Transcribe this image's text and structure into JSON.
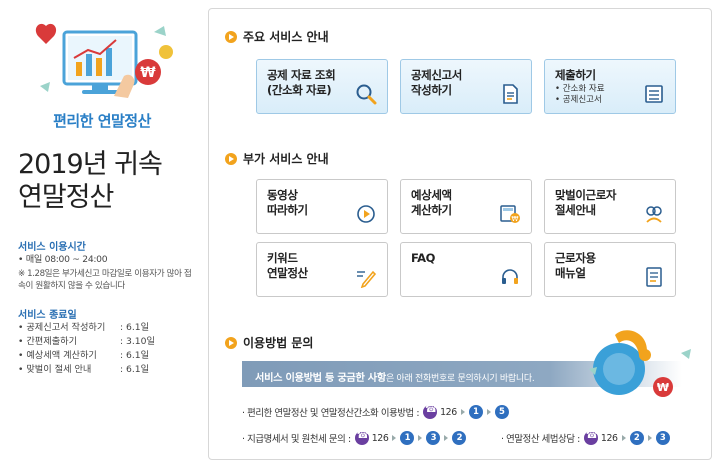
{
  "left": {
    "hero_subtitle": "편리한 연말정산",
    "title_line1": "2019년 귀속",
    "title_line2": "연말정산",
    "hours_heading": "서비스 이용시간",
    "hours_text": "• 매일 08:00 ~ 24:00",
    "hours_note": "※ 1.28일은 부가세신고 마감일로 이용자가 많아 접속이 원활하지 않을 수 있습니다",
    "end_heading": "서비스 종료일",
    "end_dates": [
      {
        "name": "공제신고서 작성하기",
        "date": ": 6.1일"
      },
      {
        "name": "간편제출하기",
        "date": ": 3.10일"
      },
      {
        "name": "예상세액 계산하기",
        "date": ": 6.1일"
      },
      {
        "name": "맞벌이 절세 안내",
        "date": ": 6.1일"
      }
    ]
  },
  "main_services": {
    "heading": "주요 서비스 안내",
    "cards": [
      {
        "label": "공제 자료 조회\n(간소화 자료)",
        "icon": "search-icon"
      },
      {
        "label": "공제신고서\n작성하기",
        "icon": "document-icon"
      },
      {
        "label": "제출하기",
        "sub": [
          "간소화 자료",
          "공제신고서"
        ],
        "icon": "submit-icon"
      }
    ]
  },
  "extra_services": {
    "heading": "부가 서비스 안내",
    "cards": [
      {
        "label": "동영상\n따라하기",
        "icon": "play-icon"
      },
      {
        "label": "예상세액\n계산하기",
        "icon": "calculator-icon"
      },
      {
        "label": "맞벌이근로자\n절세안내",
        "icon": "couple-icon"
      },
      {
        "label": "키워드\n연말정산",
        "icon": "pencil-icon"
      },
      {
        "label": "FAQ",
        "icon": "headset-icon"
      },
      {
        "label": "근로자용\n매뉴얼",
        "icon": "manual-icon"
      }
    ]
  },
  "inquiry": {
    "heading": "이용방법 문의",
    "band_bold": "서비스 이용방법 등 궁금한 사항",
    "band_rest": "은 아래 전화번호로 문의하시기 바랍니다.",
    "line1_label": "· 편리한 연말정산 및 연말정산간소화 이용방법 :",
    "line1_phone": "126",
    "line1_steps": [
      "1",
      "5"
    ],
    "line2_label": "· 지급명세서 및 원천세 문의 :",
    "line2_phone": "126",
    "line2_steps": [
      "1",
      "3",
      "2"
    ],
    "line3_label": "· 연말정산 세법상담 :",
    "line3_phone": "126",
    "line3_steps": [
      "2",
      "3"
    ]
  },
  "colors": {
    "accent": "#2a7fc6",
    "card_border": "#9fc9e6",
    "phone": "#6a3fa0",
    "step": "#2f6fbf",
    "bullet": "#f2a31d"
  }
}
